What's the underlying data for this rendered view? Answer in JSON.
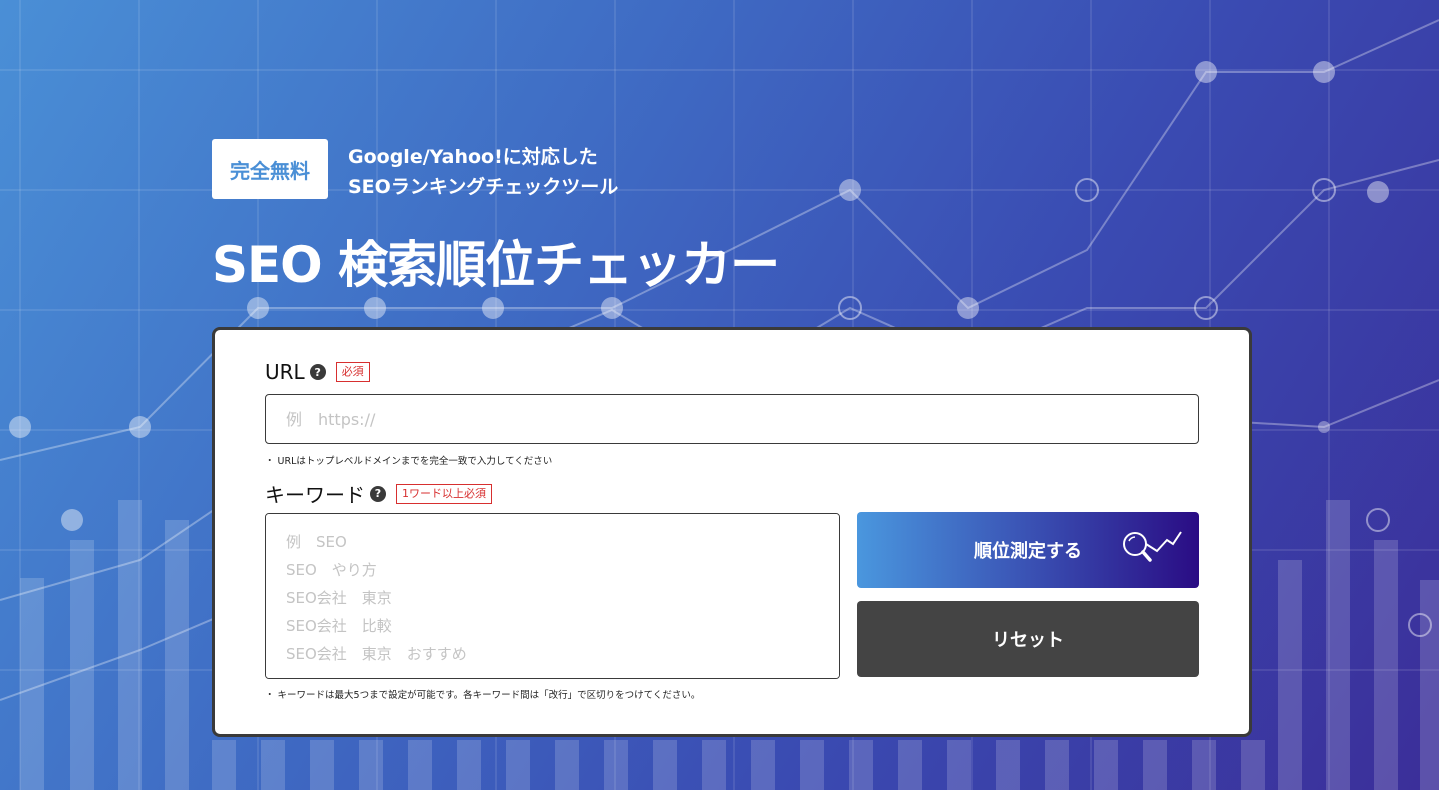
{
  "hero": {
    "badge": "完全無料",
    "lead_line1": "Google/Yahoo!に対応した",
    "lead_line2": "SEOランキングチェックツール",
    "title": "SEO 検索順位チェッカー"
  },
  "form": {
    "url": {
      "label": "URL",
      "help": "?",
      "required_tag": "必須",
      "placeholder": "例　https://",
      "value": "",
      "note": "・ URLはトップレベルドメインまでを完全一致で入力してください"
    },
    "keyword": {
      "label": "キーワード",
      "help": "?",
      "required_tag": "1ワード以上必須",
      "placeholder": "例　SEO\nSEO　やり方\nSEO会社　東京\nSEO会社　比較\nSEO会社　東京　おすすめ",
      "value": "",
      "note": "・ キーワードは最大5つまで設定が可能です。各キーワード間は「改行」で区切りをつけてください。"
    },
    "measure_button": "順位測定する",
    "reset_button": "リセット"
  },
  "icons": {
    "help": "question-circle-icon",
    "measure": "magnifier-trend-icon"
  },
  "colors": {
    "accent": "#4a8fd6",
    "required": "#d72f2f",
    "reset": "#444444",
    "gradient_end": "#2a0c84"
  }
}
